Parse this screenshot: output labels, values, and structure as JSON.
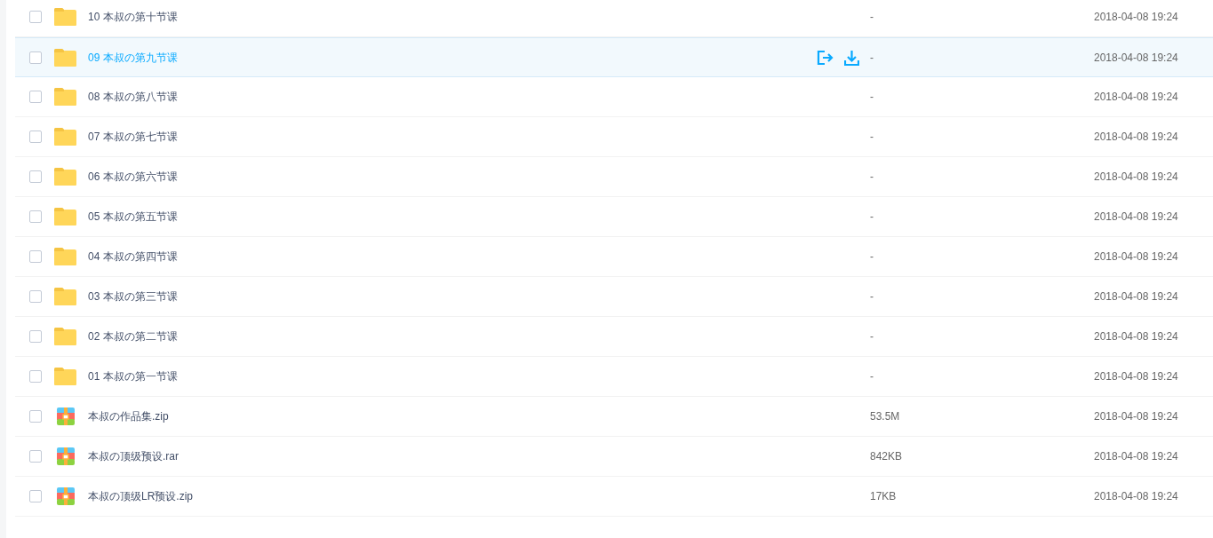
{
  "files": [
    {
      "kind": "folder",
      "name": "10 本叔の第十节课",
      "size": "-",
      "modified": "2018-04-08 19:24",
      "checked": false,
      "hovered": false
    },
    {
      "kind": "folder",
      "name": "09 本叔の第九节课",
      "size": "-",
      "modified": "2018-04-08 19:24",
      "checked": false,
      "hovered": true
    },
    {
      "kind": "folder",
      "name": "08 本叔の第八节课",
      "size": "-",
      "modified": "2018-04-08 19:24",
      "checked": false,
      "hovered": false
    },
    {
      "kind": "folder",
      "name": "07 本叔の第七节课",
      "size": "-",
      "modified": "2018-04-08 19:24",
      "checked": false,
      "hovered": false
    },
    {
      "kind": "folder",
      "name": "06 本叔の第六节课",
      "size": "-",
      "modified": "2018-04-08 19:24",
      "checked": false,
      "hovered": false
    },
    {
      "kind": "folder",
      "name": "05 本叔の第五节课",
      "size": "-",
      "modified": "2018-04-08 19:24",
      "checked": false,
      "hovered": false
    },
    {
      "kind": "folder",
      "name": "04 本叔の第四节课",
      "size": "-",
      "modified": "2018-04-08 19:24",
      "checked": false,
      "hovered": false
    },
    {
      "kind": "folder",
      "name": "03 本叔の第三节课",
      "size": "-",
      "modified": "2018-04-08 19:24",
      "checked": false,
      "hovered": false
    },
    {
      "kind": "folder",
      "name": "02 本叔の第二节课",
      "size": "-",
      "modified": "2018-04-08 19:24",
      "checked": false,
      "hovered": false
    },
    {
      "kind": "folder",
      "name": "01 本叔の第一节课",
      "size": "-",
      "modified": "2018-04-08 19:24",
      "checked": false,
      "hovered": false
    },
    {
      "kind": "archive",
      "name": "本叔の作品集.zip",
      "size": "53.5M",
      "modified": "2018-04-08 19:24",
      "checked": false,
      "hovered": false
    },
    {
      "kind": "archive",
      "name": "本叔の顶级预设.rar",
      "size": "842KB",
      "modified": "2018-04-08 19:24",
      "checked": false,
      "hovered": false
    },
    {
      "kind": "archive",
      "name": "本叔の顶级LR预设.zip",
      "size": "17KB",
      "modified": "2018-04-08 19:24",
      "checked": false,
      "hovered": false
    }
  ]
}
